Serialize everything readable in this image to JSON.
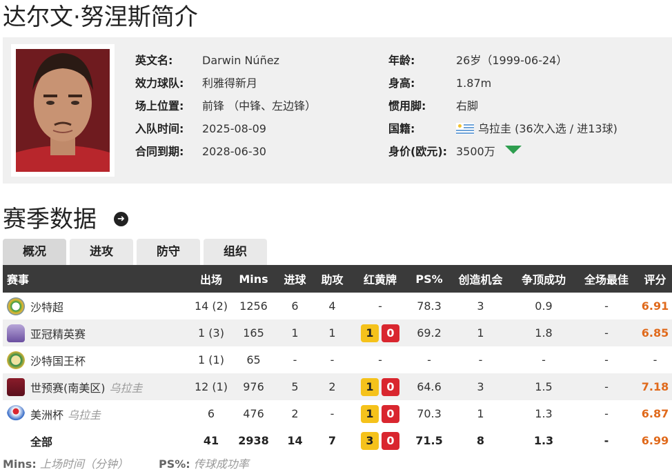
{
  "page_title": "达尔文·努涅斯简介",
  "profile": {
    "left": [
      {
        "label": "英文名:",
        "value": "Darwin Núñez"
      },
      {
        "label": "效力球队:",
        "value": "利雅得新月"
      },
      {
        "label": "场上位置:",
        "value": "前锋 （中锋、左边锋）"
      },
      {
        "label": "入队时间:",
        "value": "2025-08-09"
      },
      {
        "label": "合同到期:",
        "value": "2028-06-30"
      }
    ],
    "right": [
      {
        "label": "年龄:",
        "value": "26岁（1999-06-24）"
      },
      {
        "label": "身高:",
        "value": "1.87m"
      },
      {
        "label": "惯用脚:",
        "value": "右脚"
      },
      {
        "label": "国籍:",
        "value": "乌拉圭 (36次入选 / 进13球)"
      },
      {
        "label": "身价(欧元):",
        "value": "3500万"
      }
    ],
    "value_trend": "down",
    "trend_color": "#2e9e4f"
  },
  "section_title": "赛季数据",
  "tabs": [
    "概况",
    "进攻",
    "防守",
    "组织"
  ],
  "active_tab": 0,
  "table": {
    "headers": [
      "赛事",
      "出场",
      "Mins",
      "进球",
      "助攻",
      "红黄牌",
      "PS%",
      "创造机会",
      "争顶成功",
      "全场最佳",
      "评分"
    ],
    "rows": [
      {
        "comp": "沙特超",
        "country": "",
        "apps": "14 (2)",
        "mins": "1256",
        "goals": "6",
        "assists": "4",
        "cards": "-",
        "yellow": "",
        "red": "",
        "ps": "78.3",
        "chances": "3",
        "aerials": "0.9",
        "motm": "-",
        "rating": "6.91"
      },
      {
        "comp": "亚冠精英赛",
        "country": "",
        "apps": "1 (3)",
        "mins": "165",
        "goals": "1",
        "assists": "1",
        "cards": "",
        "yellow": "1",
        "red": "0",
        "ps": "69.2",
        "chances": "1",
        "aerials": "1.8",
        "motm": "-",
        "rating": "6.85"
      },
      {
        "comp": "沙特国王杯",
        "country": "",
        "apps": "1 (1)",
        "mins": "65",
        "goals": "-",
        "assists": "-",
        "cards": "-",
        "yellow": "",
        "red": "",
        "ps": "-",
        "chances": "-",
        "aerials": "-",
        "motm": "-",
        "rating": "-"
      },
      {
        "comp": "世预赛(南美区)",
        "country": "乌拉圭",
        "apps": "12 (1)",
        "mins": "976",
        "goals": "5",
        "assists": "2",
        "cards": "",
        "yellow": "1",
        "red": "0",
        "ps": "64.6",
        "chances": "3",
        "aerials": "1.5",
        "motm": "-",
        "rating": "7.18"
      },
      {
        "comp": "美洲杯",
        "country": "乌拉圭",
        "apps": "6",
        "mins": "476",
        "goals": "2",
        "assists": "-",
        "cards": "",
        "yellow": "1",
        "red": "0",
        "ps": "70.3",
        "chances": "1",
        "aerials": "1.3",
        "motm": "-",
        "rating": "6.87"
      }
    ],
    "total": {
      "comp": "全部",
      "apps": "41",
      "mins": "2938",
      "goals": "14",
      "assists": "7",
      "yellow": "3",
      "red": "0",
      "ps": "71.5",
      "chances": "8",
      "aerials": "1.3",
      "motm": "-",
      "rating": "6.99"
    },
    "rating_color": "#e06a1c"
  },
  "footnotes": [
    {
      "key": "Mins:",
      "text": "上场时间（分钟）"
    },
    {
      "key": "PS%:",
      "text": "传球成功率"
    }
  ]
}
